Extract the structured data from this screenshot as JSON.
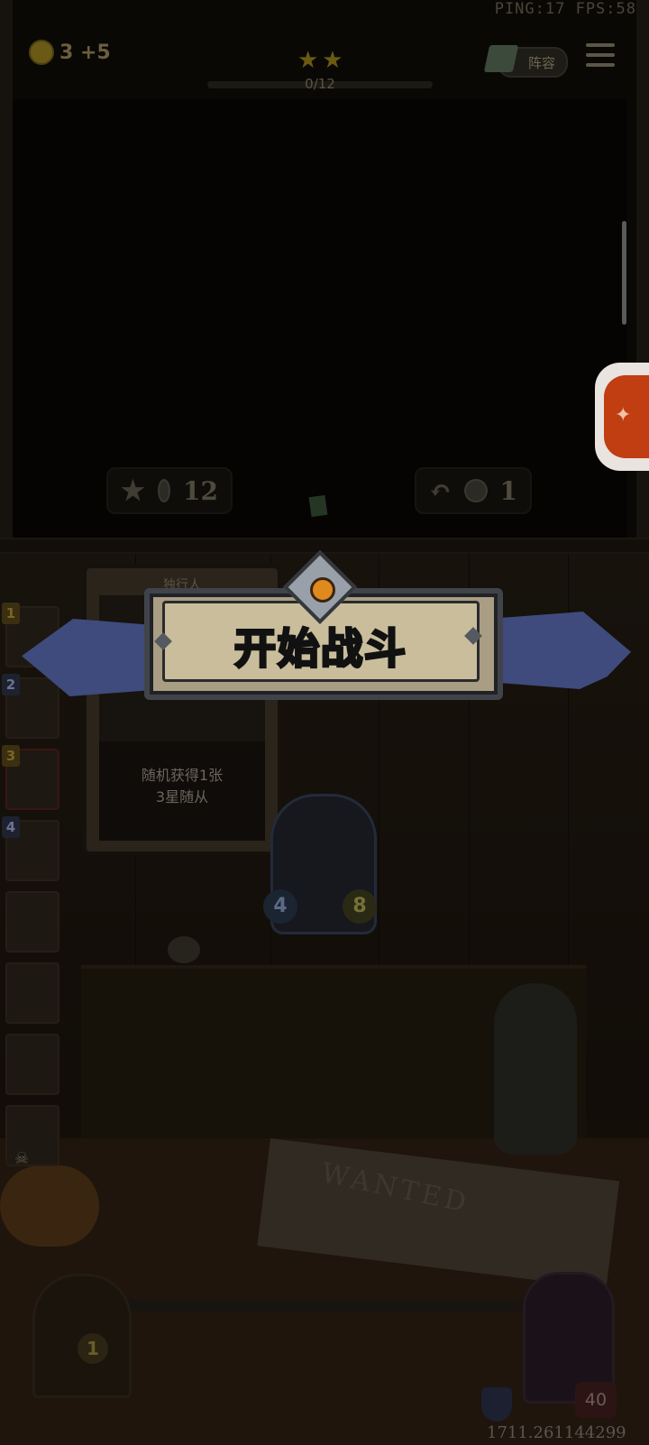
{
  "hud": {
    "perf": "PING:17   FPS:58",
    "gold": "3 +5",
    "stars": "★★",
    "progress_label": "0/12",
    "progress_value": 0,
    "lineup_label": "阵容"
  },
  "shop": {
    "upgrade_cost": "12",
    "refresh_cost": "1"
  },
  "banner": {
    "title": "开始战斗"
  },
  "card": {
    "name": "独行人",
    "description_line1": "随机获得1张",
    "description_line2": "3星随从"
  },
  "minion_list": [
    {
      "tier": "1"
    },
    {
      "tier": "2"
    },
    {
      "tier": "3"
    },
    {
      "tier": "4"
    },
    {
      "tier": ""
    },
    {
      "tier": ""
    },
    {
      "tier": ""
    },
    {
      "tier": ""
    }
  ],
  "center_minion": {
    "attack": "4",
    "health": "8"
  },
  "table": {
    "poster_text": "WANTED"
  },
  "bottom": {
    "tavern_level": "1",
    "hero_health": "40",
    "coords": "1711.261144299"
  },
  "icons": {
    "gold": "coin-icon",
    "lineup": "book-icon",
    "menu": "hamburger-icon",
    "upgrade": "star-up-icon",
    "refresh": "refresh-icon",
    "freeze": "freeze-icon",
    "chat": "chat-icon",
    "armor": "shield-icon"
  },
  "colors": {
    "banner_ribbon": "#3e4b7c",
    "plank": "#c9bd9c",
    "gem": "#e08a1e",
    "floating_button": "#c13d12"
  }
}
